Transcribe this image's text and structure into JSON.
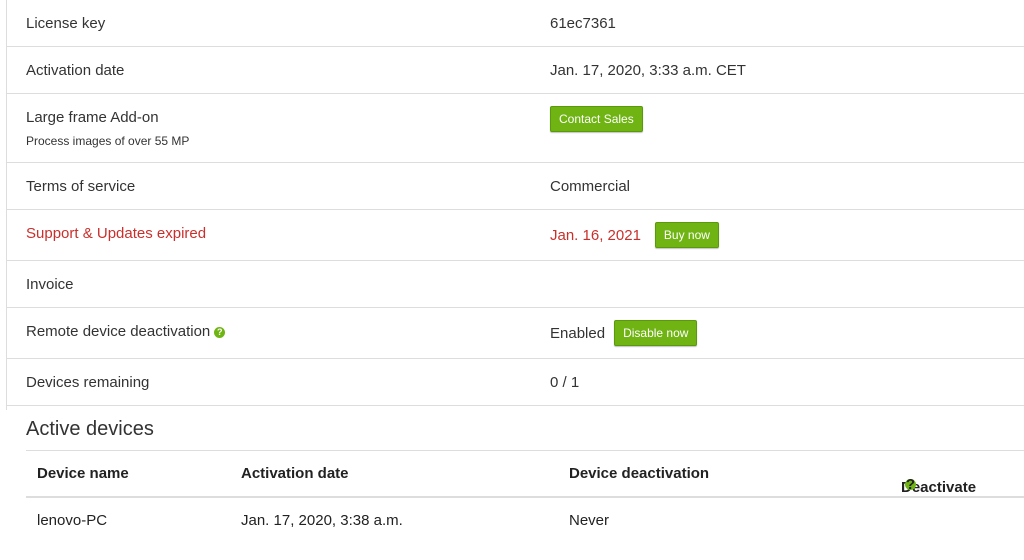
{
  "license": {
    "license_key_label": "License key",
    "license_key_value": "61ec7361",
    "activation_date_label": "Activation date",
    "activation_date_value": "Jan. 17, 2020, 3:33 a.m. CET",
    "large_frame_label": "Large frame Add-on",
    "large_frame_sub": "Process images of over 55 MP",
    "contact_sales_label": "Contact Sales",
    "terms_label": "Terms of service",
    "terms_value": "Commercial",
    "support_label": "Support & Updates expired",
    "support_value": "Jan. 16, 2021",
    "buy_now_label": "Buy now",
    "invoice_label": "Invoice",
    "remote_label": "Remote device deactivation",
    "remote_value": "Enabled",
    "disable_now_label": "Disable now",
    "devices_remaining_label": "Devices remaining",
    "devices_remaining_value": "0 / 1"
  },
  "active_devices": {
    "title": "Active devices",
    "columns": [
      "Device name",
      "Activation date",
      "Device deactivation",
      "Deactivate"
    ],
    "rows": [
      [
        "lenovo-PC",
        "Jan. 17, 2020, 3:38 a.m.",
        "Never"
      ]
    ]
  },
  "icons": {
    "help": "?"
  },
  "colors": {
    "accent": "#6fb413",
    "danger": "#c9302c"
  }
}
